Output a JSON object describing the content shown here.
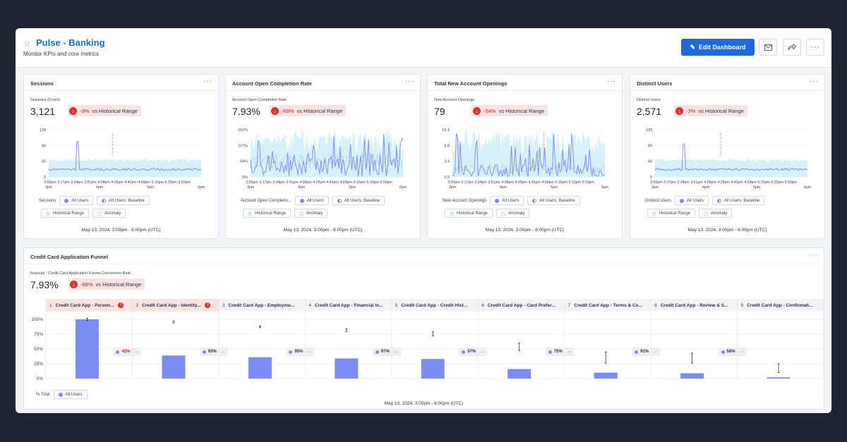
{
  "header": {
    "title": "Pulse - Banking",
    "subtitle": "Monitor KPIs and core metrics",
    "edit_label": "Edit Dashboard",
    "star_icon": "star-icon",
    "mail_icon": "mail-icon",
    "share_icon": "share-icon",
    "more_icon": "more-icon"
  },
  "colors": {
    "accent": "#1d6ad8",
    "series": "#7b8cf2",
    "baseline": "#a8b1f0",
    "historical": "#c8ecf7",
    "anomaly": "#f2a5b8",
    "negative": "#d93232"
  },
  "common": {
    "date_range": "May 13, 2024, 3:00pm - 6:00pm (UTC)",
    "vs_label": "vs Historical Range",
    "legend_all_users": "All Users",
    "legend_baseline": "All Users; Baseline",
    "legend_historical": "Historical Range",
    "legend_anomaly": "Anomaly",
    "x_ticks_top": [
      "3:00pm",
      "3:17pm",
      "3:34pm",
      "3:51pm",
      "4:08pm",
      "4:25pm",
      "4:42pm",
      "4:59pm",
      "5:16pm",
      "5:33pm",
      "5:50pm"
    ],
    "x_ticks_bottom": [
      "3pm",
      "4pm",
      "5pm",
      "6pm"
    ]
  },
  "cards": [
    {
      "title": "Sessions",
      "metric_label": "Sessions (Count)",
      "value": "3,121",
      "pct": "-3%",
      "y_ticks": [
        "134",
        "89",
        "45",
        "0"
      ],
      "legend_label": "Sessions",
      "chart_data": {
        "type": "line",
        "ylim": [
          0,
          134
        ],
        "level": 0.16,
        "noise": 0.05,
        "spike_at": 0.19,
        "spike": 0.75,
        "anomaly_at": 0.42
      }
    },
    {
      "title": "Account Open Completion Rate",
      "metric_label": "Account Open Completion Rate",
      "value": "7.93%",
      "pct": "-69%",
      "y_ticks": [
        "161%",
        "107%",
        "54%",
        "0%"
      ],
      "legend_label": "Account Open Completio...",
      "chart_data": {
        "type": "line",
        "ylim": [
          0,
          161
        ],
        "level": 0.35,
        "noise": 0.55,
        "spike_at": -1,
        "spike": 0,
        "anomaly_at": -1
      }
    },
    {
      "title": "Total New Account Openings",
      "metric_label": "New Account Openings",
      "value": "79",
      "pct": "-54%",
      "y_ticks": [
        "10.1",
        "6.8",
        "3.4",
        "0.0"
      ],
      "legend_label": "New Account Openings",
      "chart_data": {
        "type": "line",
        "ylim": [
          0,
          10.1
        ],
        "level": 0.18,
        "noise": 0.35,
        "spike_at": 0.05,
        "spike": 0.75,
        "anomaly_at": 0.6
      }
    },
    {
      "title": "Distinct Users",
      "metric_label": "Distinct Users",
      "value": "2,571",
      "pct": "-3%",
      "y_ticks": [
        "133",
        "89",
        "44",
        "0"
      ],
      "legend_label": "Distinct Users",
      "chart_data": {
        "type": "line",
        "ylim": [
          0,
          133
        ],
        "level": 0.16,
        "noise": 0.05,
        "spike_at": 0.19,
        "spike": 0.7,
        "anomaly_at": 0.43
      }
    }
  ],
  "funnel": {
    "title": "Credit Card Application Funnel",
    "metric_label": "financial - Credit Card Application Funnel Conversion Rate",
    "value": "7.93%",
    "pct": "-68%",
    "y_ticks": [
      "100%",
      "75%",
      "50%",
      "25%",
      "0%"
    ],
    "total_label": "% Total",
    "legend_all_users": "All Users",
    "steps": [
      {
        "num": "1",
        "label": "Credit Card App - Person...",
        "alert": "!"
      },
      {
        "num": "2",
        "label": "Credit Card App - Identity...",
        "alert": "!"
      },
      {
        "num": "3",
        "label": "Credit Card App - Employme...",
        "alert": ""
      },
      {
        "num": "4",
        "label": "Credit Card App - Financial In...",
        "alert": ""
      },
      {
        "num": "5",
        "label": "Credit Card App - Credit Hist...",
        "alert": ""
      },
      {
        "num": "6",
        "label": "Credit Card App - Card Prefer...",
        "alert": ""
      },
      {
        "num": "7",
        "label": "Credit Card App - Terms & Co...",
        "alert": ""
      },
      {
        "num": "8",
        "label": "Credit Card App - Review & S...",
        "alert": ""
      },
      {
        "num": "9",
        "label": "Credit Card App - Confirmati...",
        "alert": ""
      }
    ],
    "conversions": [
      "42%",
      "93%",
      "95%",
      "97%",
      "57%",
      "75%",
      "91%",
      "56%"
    ],
    "chart_data": {
      "type": "bar",
      "categories": [
        "1",
        "2",
        "3",
        "4",
        "5",
        "6",
        "7",
        "8",
        "9"
      ],
      "values": [
        100,
        39,
        36,
        34,
        33,
        16,
        10,
        9,
        2
      ],
      "error_low": [
        98,
        94,
        86,
        79,
        72,
        47,
        26,
        26,
        10
      ],
      "error_high": [
        102,
        97,
        89,
        84,
        79,
        60,
        45,
        43,
        25
      ],
      "ylim": [
        0,
        100
      ]
    }
  }
}
